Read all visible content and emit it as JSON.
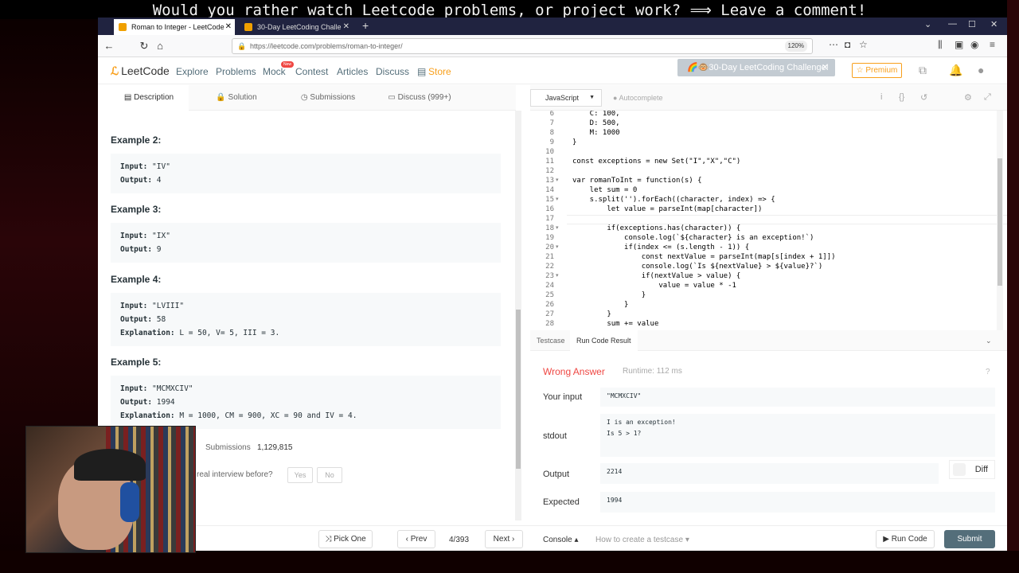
{
  "banner": {
    "text": "Would you rather watch Leetcode problems, or project work? ⟹ Leave a comment!"
  },
  "browser": {
    "tabs": [
      {
        "title": "Roman to Integer - LeetCode",
        "active": true
      },
      {
        "title": "30-Day LeetCoding Challe",
        "active": false
      }
    ],
    "new_tab": "+",
    "url": "https://leetcode.com/problems/roman-to-integer/",
    "zoom": "120%"
  },
  "site_nav": {
    "logo": "LeetCode",
    "items": [
      "Explore",
      "Problems",
      "Mock",
      "Contest",
      "Articles",
      "Discuss",
      "Store"
    ],
    "new_badge": "New",
    "challenge_banner": "🌈🐵30-Day LeetCoding Challenge!",
    "premium": "Premium"
  },
  "left_tabs": [
    "Description",
    "Solution",
    "Submissions",
    "Discuss (999+)"
  ],
  "examples": [
    {
      "heading": "Example 2:",
      "lines": [
        [
          "Input:",
          " \"IV\""
        ],
        [
          "Output:",
          " 4"
        ]
      ]
    },
    {
      "heading": "Example 3:",
      "lines": [
        [
          "Input:",
          " \"IX\""
        ],
        [
          "Output:",
          " 9"
        ]
      ]
    },
    {
      "heading": "Example 4:",
      "lines": [
        [
          "Input:",
          " \"LVIII\""
        ],
        [
          "Output:",
          " 58"
        ],
        [
          "Explanation:",
          " L = 50, V= 5, III = 3."
        ]
      ]
    },
    {
      "heading": "Example 5:",
      "lines": [
        [
          "Input:",
          " \"MCMXCIV\""
        ],
        [
          "Output:",
          " 1994"
        ],
        [
          "Explanation:",
          " M = 1000, CM = 900, XC = 90 and IV = 4."
        ]
      ]
    }
  ],
  "stats": {
    "submissions_label": "Submissions",
    "submissions_value": "1,129,815",
    "interview_question": "real interview before?",
    "yes": "Yes",
    "no": "No"
  },
  "editor": {
    "language": "JavaScript",
    "autocomplete": "Autocomplete",
    "line_numbers": [
      "6",
      "7",
      "8",
      "9",
      "10",
      "11",
      "12",
      "13",
      "14",
      "15",
      "16",
      "17",
      "18",
      "19",
      "20",
      "21",
      "22",
      "23",
      "24",
      "25",
      "26",
      "27",
      "28"
    ],
    "code_lines": [
      "    C: 100,",
      "    D: 500,",
      "    M: 1000",
      "}",
      "",
      "const exceptions = new Set(\"I\",\"X\",\"C\")",
      "",
      "var romanToInt = function(s) {",
      "    let sum = 0",
      "    s.split('').forEach((character, index) => {",
      "        let value = parseInt(map[character])",
      "",
      "        if(exceptions.has(character)) {",
      "            console.log(`${character} is an exception!`)",
      "            if(index <= (s.length - 1)) {",
      "                const nextValue = parseInt(map[s[index + 1]])",
      "                console.log(`Is ${nextValue} > ${value}?`)",
      "                if(nextValue > value) {",
      "                    value = value * -1",
      "                }",
      "            }",
      "        }",
      "        sum += value"
    ]
  },
  "result_tabs": [
    "Testcase",
    "Run Code Result"
  ],
  "result": {
    "verdict": "Wrong Answer",
    "runtime": "Runtime: 112 ms",
    "your_input_label": "Your input",
    "your_input": "\"MCMXCIV\"",
    "stdout_label": "stdout",
    "stdout_lines": [
      "I is an exception!",
      "Is 5 > 1?"
    ],
    "output_label": "Output",
    "output": "2214",
    "diff": "Diff",
    "expected_label": "Expected",
    "expected": "1994"
  },
  "footer": {
    "pick_one": "Pick One",
    "prev": "Prev",
    "page": "4/393",
    "next": "Next",
    "console": "Console",
    "how_to": "How to create a testcase",
    "run_code": "Run Code",
    "submit": "Submit"
  },
  "colors": {
    "accent": "#f89f1b",
    "error": "#ef4743",
    "submit": "#546e7a"
  }
}
